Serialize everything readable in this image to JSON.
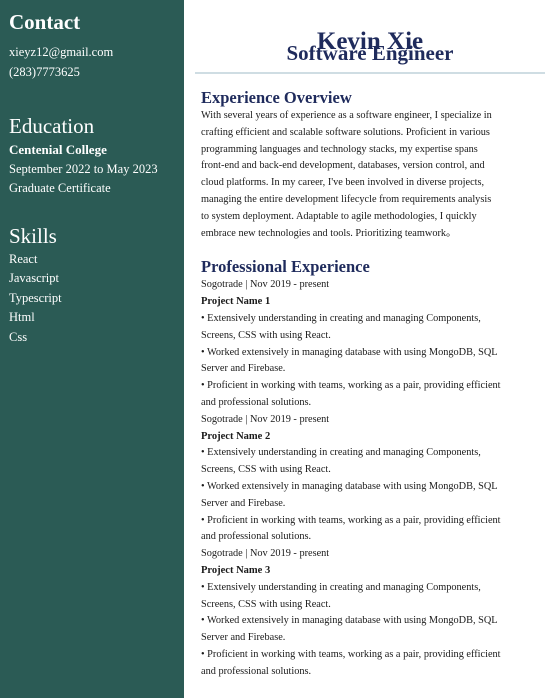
{
  "sidebar": {
    "contact": {
      "heading": "Contact",
      "email": "xieyz12@gmail.com",
      "phone": "(283)7773625"
    },
    "education": {
      "heading": "Education",
      "school": "Centenial College",
      "dates": "September 2022 to May 2023",
      "credential": "Graduate Certificate"
    },
    "skills": {
      "heading": "Skills",
      "items": [
        "React",
        "Javascript",
        "Typescript",
        "Html",
        "Css"
      ]
    }
  },
  "header": {
    "name": "Kevin Xie",
    "title": "Software Engineer"
  },
  "overview": {
    "heading": "Experience Overview",
    "lines": [
      "With several years of experience as a software engineer, I specialize in",
      "crafting efficient and scalable software solutions. Proficient in various",
      "programming languages and technology stacks, my expertise spans",
      "front-end and back-end development, databases, version control, and",
      "cloud platforms. In my career, I've been involved in diverse projects,",
      "managing the entire development lifecycle from requirements analysis",
      "to system deployment. Adaptable to agile methodologies, I quickly",
      "embrace new technologies and tools. Prioritizing teamwork。"
    ]
  },
  "experience": {
    "heading": "Professional Experience",
    "jobs": [
      {
        "company_line": "Sogotrade | Nov 2019 - present",
        "project": "Project Name 1",
        "bullet_lines": [
          "• Extensively understanding in creating and managing Components,",
          "Screens, CSS with using React.",
          "• Worked extensively in managing database with using MongoDB, SQL",
          "Server and Firebase.",
          "• Proficient in working with teams, working as a pair, providing efficient",
          "and professional solutions."
        ]
      },
      {
        "company_line": "Sogotrade | Nov 2019 - present",
        "project": "Project Name 2",
        "bullet_lines": [
          "• Extensively understanding in creating and managing Components,",
          "Screens, CSS with using React.",
          "• Worked extensively in managing database with using MongoDB, SQL",
          "Server and Firebase.",
          "• Proficient in working with teams, working as a pair, providing efficient",
          "and professional solutions."
        ]
      },
      {
        "company_line": "Sogotrade | Nov 2019 - present",
        "project": "Project Name 3",
        "bullet_lines": [
          "• Extensively understanding in creating and managing Components,",
          "Screens, CSS with using React.",
          "• Worked extensively in managing database with using MongoDB, SQL",
          "Server and Firebase.",
          "• Proficient in working with teams, working as a pair, providing efficient",
          "and professional solutions."
        ]
      }
    ]
  },
  "colors": {
    "sidebar_bg": "#2b5b55",
    "heading_navy": "#1f2b5c",
    "rule": "#cfdde3"
  }
}
